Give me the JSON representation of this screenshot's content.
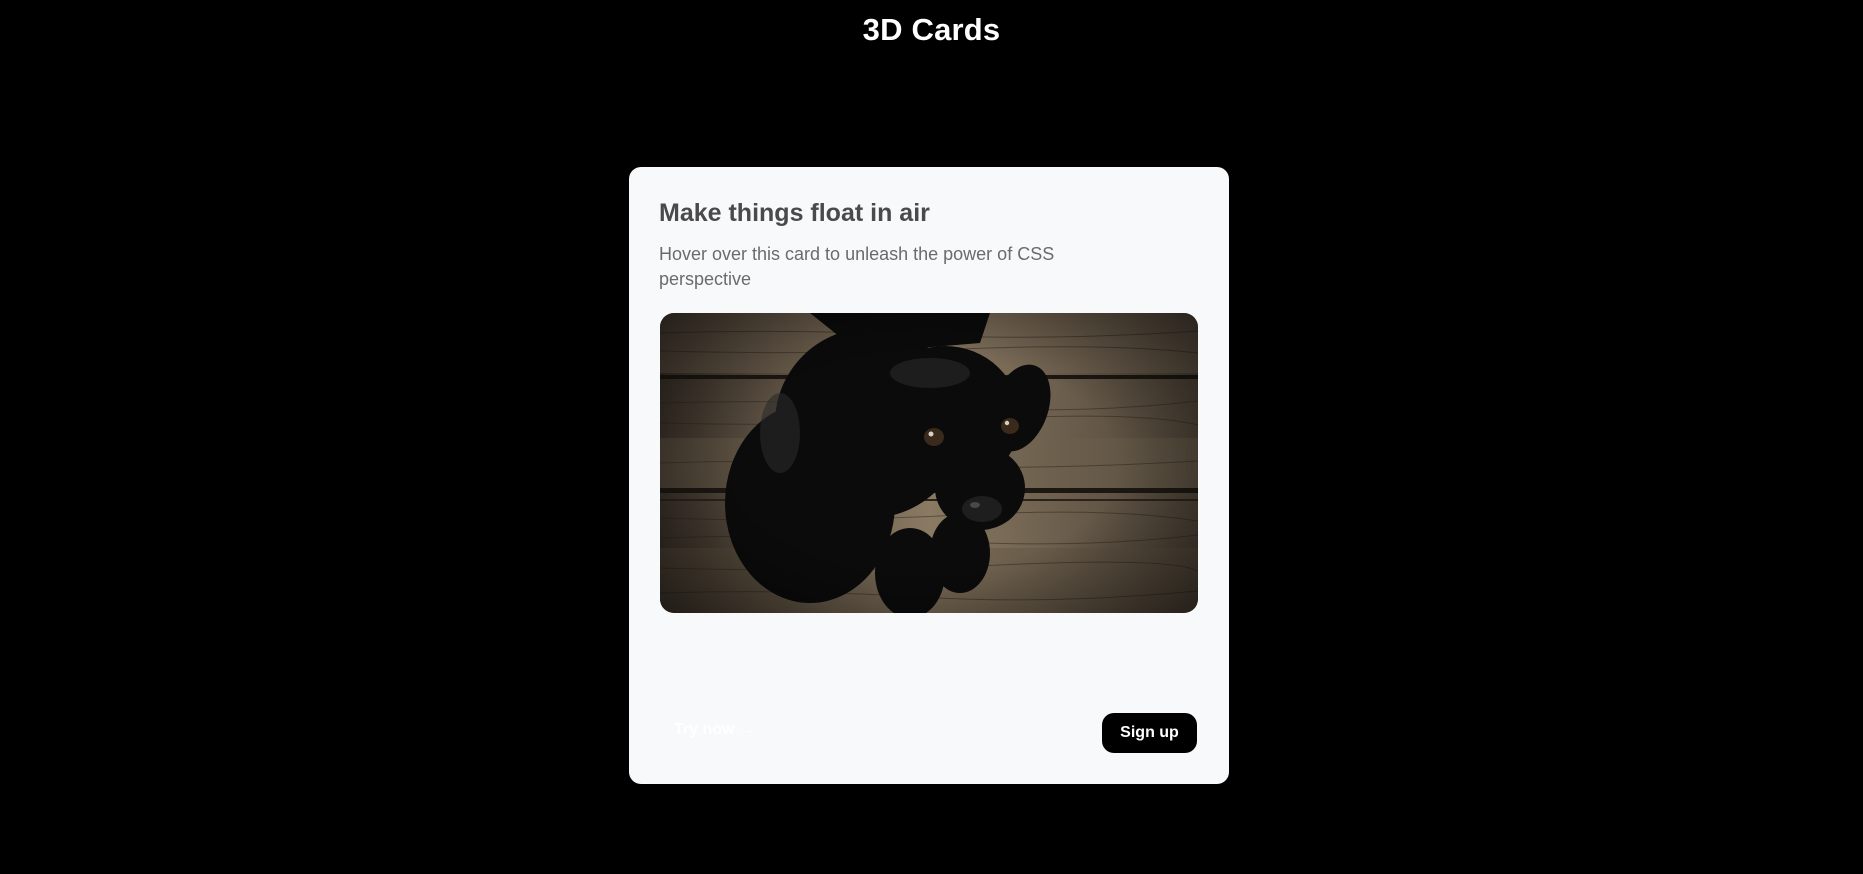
{
  "header": {
    "title": "3D Cards"
  },
  "card": {
    "heading": "Make things float in air",
    "description": "Hover over this card to unleash the power of CSS perspective",
    "image_subject": "black puppy on wooden floor",
    "try_link_label": "Try now →",
    "signup_label": "Sign up"
  },
  "colors": {
    "page_background": "#000000",
    "card_background": "#f8f9fa",
    "heading_text": "#4a4a4a",
    "description_text": "#6b6b6b",
    "button_background": "#000000",
    "button_text": "#ffffff"
  }
}
